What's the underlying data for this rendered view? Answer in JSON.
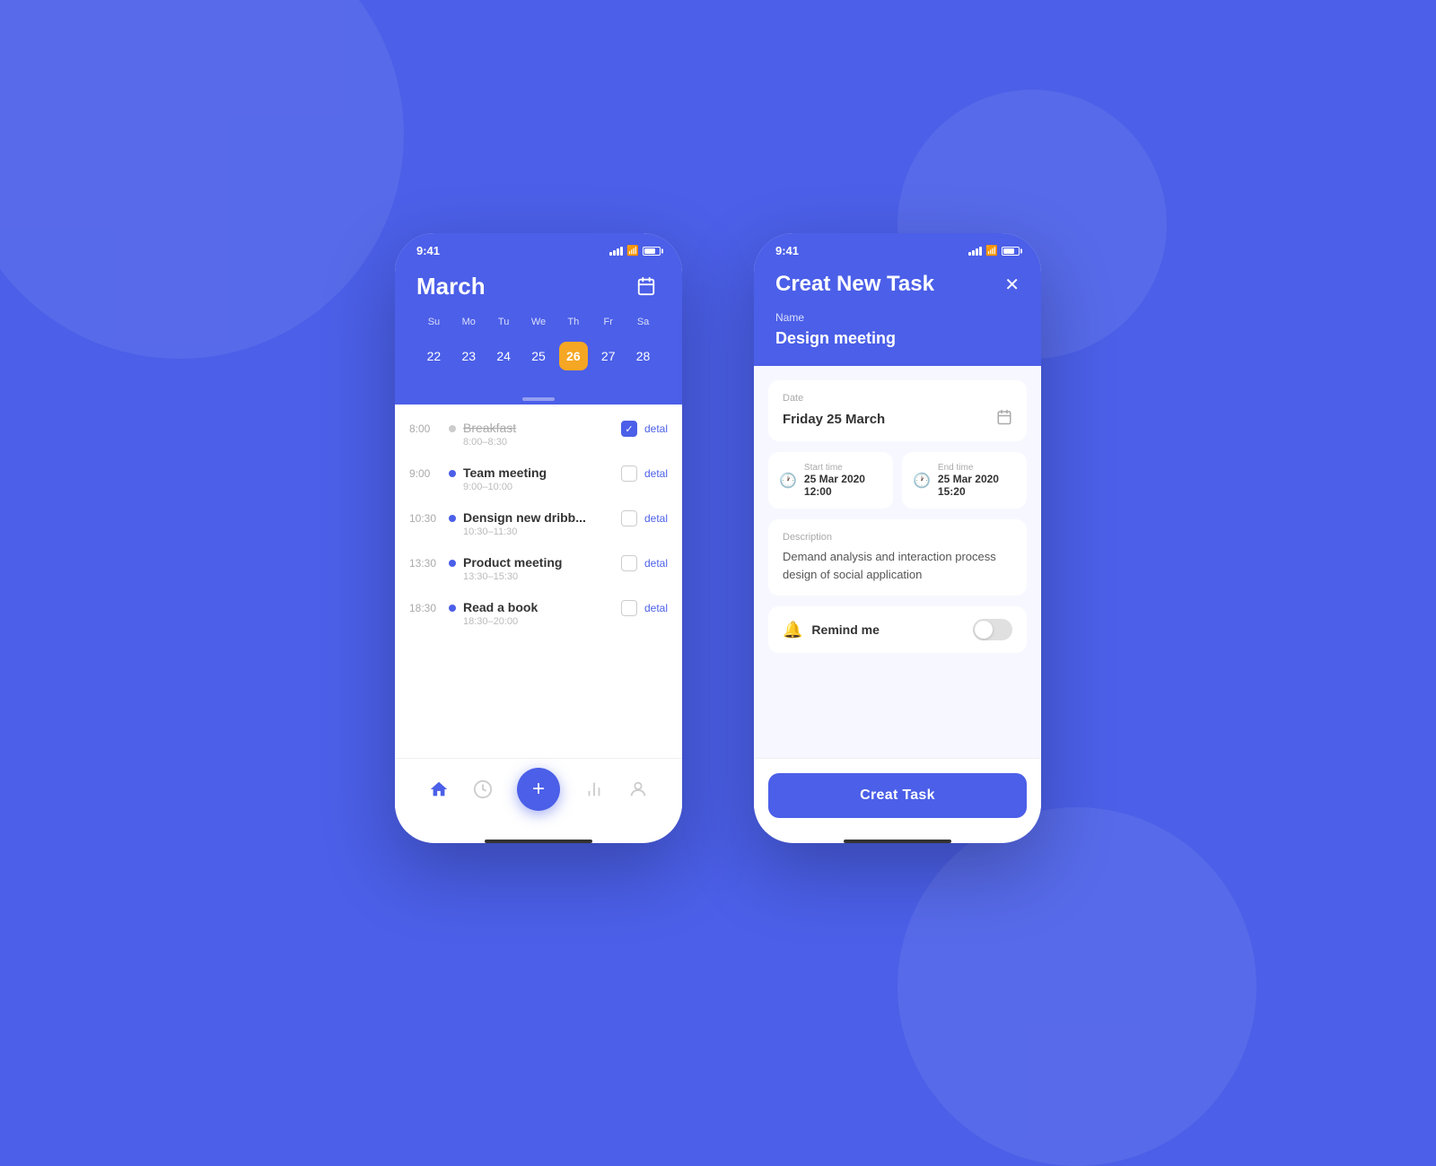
{
  "background": {
    "color": "#4B5FE8"
  },
  "phone1": {
    "status_bar": {
      "time": "9:41",
      "signal": "signal-icon",
      "wifi": "wifi-icon",
      "battery": "battery-icon"
    },
    "header": {
      "month": "March",
      "calendar_icon": "calendar-icon"
    },
    "weekdays": [
      "Su",
      "Mo",
      "Tu",
      "We",
      "Th",
      "Fr",
      "Sa"
    ],
    "dates": [
      {
        "num": "22",
        "active": false
      },
      {
        "num": "23",
        "active": false
      },
      {
        "num": "24",
        "active": false
      },
      {
        "num": "25",
        "active": false
      },
      {
        "num": "26",
        "active": true
      },
      {
        "num": "27",
        "active": false
      },
      {
        "num": "28",
        "active": false
      }
    ],
    "tasks": [
      {
        "time": "8:00",
        "name": "Breakfast",
        "range": "8:00–8:30",
        "checked": true,
        "strikethrough": true,
        "detail": "detal"
      },
      {
        "time": "9:00",
        "name": "Team meeting",
        "range": "9:00–10:00",
        "checked": false,
        "strikethrough": false,
        "detail": "detal"
      },
      {
        "time": "10:30",
        "name": "Densign new dribb..",
        "range": "10:30–11:30",
        "checked": false,
        "strikethrough": false,
        "detail": "detal"
      },
      {
        "time": "13:30",
        "name": "Product meeting",
        "range": "13:30–15:30",
        "checked": false,
        "strikethrough": false,
        "detail": "detal"
      },
      {
        "time": "18:30",
        "name": "Read a book",
        "range": "18:30–20:00",
        "checked": false,
        "strikethrough": false,
        "detail": "detal"
      }
    ],
    "nav": {
      "home_icon": "home-icon",
      "clock_icon": "clock-icon",
      "add_label": "+",
      "chart_icon": "chart-icon",
      "profile_icon": "profile-icon"
    }
  },
  "phone2": {
    "status_bar": {
      "time": "9:41"
    },
    "header": {
      "title": "Creat New Task",
      "close_icon": "close-icon",
      "name_label": "Name",
      "name_value": "Design meeting"
    },
    "form": {
      "date_label": "Date",
      "date_value": "Friday 25 March",
      "start_label": "Start time",
      "start_value": "25 Mar 2020  12:00",
      "end_label": "End time",
      "end_value": "25 Mar 2020  15:20",
      "desc_label": "Description",
      "desc_value": "Demand analysis and interaction process design of social application",
      "remind_label": "Remind me",
      "remind_toggle": false
    },
    "create_button": "Creat Task"
  }
}
